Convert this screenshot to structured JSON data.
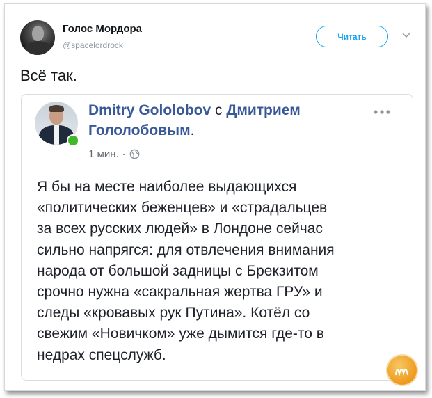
{
  "tweet": {
    "author_name": "Голос Мордора",
    "author_handle": "@spacelordrock",
    "follow_label": "Читать",
    "text": "Всё так."
  },
  "fb_post": {
    "author": "Dmitry Gololobov",
    "with_word": " с ",
    "with_name": "Дмитрием",
    "with_name_line2": "Гололобовым",
    "name_end": ".",
    "time": "1 мин.",
    "separator": "·",
    "menu_icon": "ellipsis-icon",
    "privacy_icon": "globe-icon",
    "text_lines": [
      "Я бы на месте наиболее выдающихся",
      "«политических беженцев» и «страдальцев",
      "за всех русских людей» в Лондоне сейчас",
      "сильно напрягся: для отвлечения внимания",
      "народа от большой задницы с Брекзитом",
      "срочно нужна «сакральная жертва ГРУ» и",
      "следы «кровавых рук Путина». Котёл со",
      "свежим «Новичком» уже дымится где-то в",
      "недрах спецслужб."
    ]
  },
  "colors": {
    "twitter_blue": "#1da1f2",
    "fb_link_blue": "#385898",
    "online_green": "#42b72a"
  }
}
